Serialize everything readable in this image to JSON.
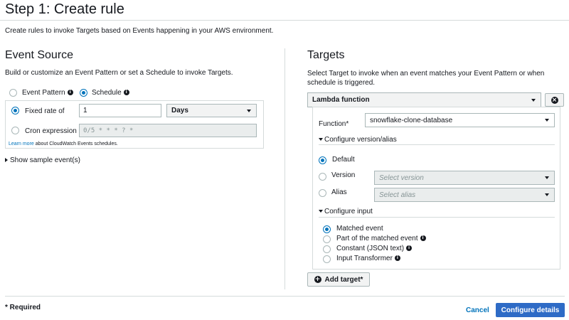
{
  "header": {
    "title": "Step 1: Create rule",
    "description": "Create rules to invoke Targets based on Events happening in your AWS environment."
  },
  "event_source": {
    "heading": "Event Source",
    "description": "Build or customize an Event Pattern or set a Schedule to invoke Targets.",
    "type_options": [
      {
        "label": "Event Pattern",
        "selected": false
      },
      {
        "label": "Schedule",
        "selected": true
      }
    ],
    "info_glyph": "i",
    "fixed_rate": {
      "label": "Fixed rate of",
      "selected": true,
      "value": "1",
      "unit": "Days"
    },
    "cron": {
      "label": "Cron expression",
      "selected": false,
      "value": "0/5 * * * ? *"
    },
    "learn_more": {
      "link": "Learn more",
      "text": " about CloudWatch Events schedules."
    },
    "show_sample": "Show sample event(s)"
  },
  "targets": {
    "heading": "Targets",
    "description": "Select Target to invoke when an event matches your Event Pattern or when schedule is triggered.",
    "target_type": "Lambda function",
    "remove_glyph": "×",
    "function_label": "Function*",
    "function_value": "snowflake-clone-database",
    "version_section": {
      "title": "Configure version/alias",
      "options": [
        {
          "label": "Default",
          "selected": true
        },
        {
          "label": "Version",
          "selected": false,
          "placeholder": "Select version"
        },
        {
          "label": "Alias",
          "selected": false,
          "placeholder": "Select alias"
        }
      ]
    },
    "input_section": {
      "title": "Configure input",
      "options": [
        {
          "label": "Matched event",
          "selected": true,
          "info": false
        },
        {
          "label": "Part of the matched event",
          "selected": false,
          "info": true
        },
        {
          "label": "Constant (JSON text)",
          "selected": false,
          "info": true
        },
        {
          "label": "Input Transformer",
          "selected": false,
          "info": true
        }
      ]
    },
    "add_target": "Add target*",
    "add_glyph": "+"
  },
  "footer": {
    "required_note": "* Required",
    "cancel": "Cancel",
    "configure_details": "Configure details"
  },
  "colors": {
    "primary": "#0073bb",
    "primary_button": "#2e6bc6",
    "border": "#aab7b8"
  }
}
